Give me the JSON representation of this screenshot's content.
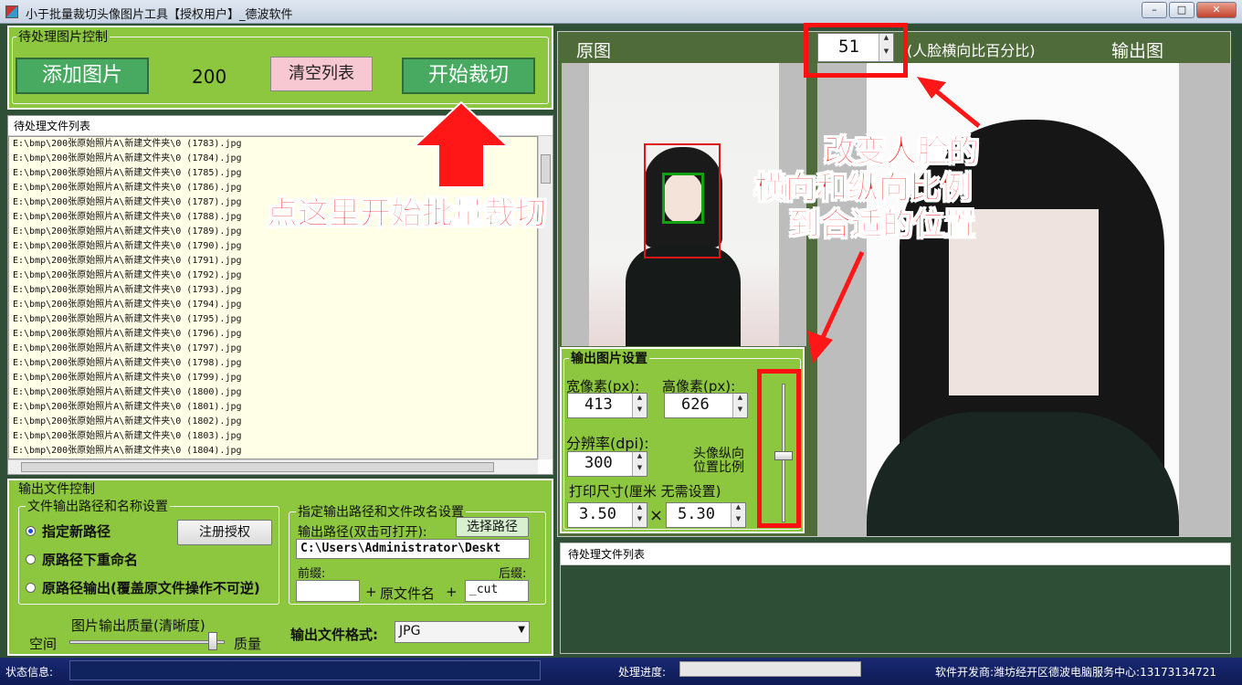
{
  "window": {
    "title": "小于批量裁切头像图片工具【授权用户】_德波软件",
    "min_label": "–",
    "max_label": "□",
    "close_label": "✕"
  },
  "pending_control": {
    "group_title": "待处理图片控制",
    "add_button": "添加图片",
    "count": "200",
    "clear_button": "清空列表",
    "start_button": "开始裁切"
  },
  "file_list": {
    "header": "待处理文件列表",
    "items": [
      "E:\\bmp\\200张原始照片A\\新建文件夹\\0 (1783).jpg",
      "E:\\bmp\\200张原始照片A\\新建文件夹\\0 (1784).jpg",
      "E:\\bmp\\200张原始照片A\\新建文件夹\\0 (1785).jpg",
      "E:\\bmp\\200张原始照片A\\新建文件夹\\0 (1786).jpg",
      "E:\\bmp\\200张原始照片A\\新建文件夹\\0 (1787).jpg",
      "E:\\bmp\\200张原始照片A\\新建文件夹\\0 (1788).jpg",
      "E:\\bmp\\200张原始照片A\\新建文件夹\\0 (1789).jpg",
      "E:\\bmp\\200张原始照片A\\新建文件夹\\0 (1790).jpg",
      "E:\\bmp\\200张原始照片A\\新建文件夹\\0 (1791).jpg",
      "E:\\bmp\\200张原始照片A\\新建文件夹\\0 (1792).jpg",
      "E:\\bmp\\200张原始照片A\\新建文件夹\\0 (1793).jpg",
      "E:\\bmp\\200张原始照片A\\新建文件夹\\0 (1794).jpg",
      "E:\\bmp\\200张原始照片A\\新建文件夹\\0 (1795).jpg",
      "E:\\bmp\\200张原始照片A\\新建文件夹\\0 (1796).jpg",
      "E:\\bmp\\200张原始照片A\\新建文件夹\\0 (1797).jpg",
      "E:\\bmp\\200张原始照片A\\新建文件夹\\0 (1798).jpg",
      "E:\\bmp\\200张原始照片A\\新建文件夹\\0 (1799).jpg",
      "E:\\bmp\\200张原始照片A\\新建文件夹\\0 (1800).jpg",
      "E:\\bmp\\200张原始照片A\\新建文件夹\\0 (1801).jpg",
      "E:\\bmp\\200张原始照片A\\新建文件夹\\0 (1802).jpg",
      "E:\\bmp\\200张原始照片A\\新建文件夹\\0 (1803).jpg",
      "E:\\bmp\\200张原始照片A\\新建文件夹\\0 (1804).jpg"
    ]
  },
  "annotations": {
    "click_here": "点这里开始批量裁切",
    "change_ratio_1": "改变人脸的",
    "change_ratio_2": "横向和纵向比例",
    "change_ratio_3": "到合适的位置"
  },
  "output_control": {
    "group_title": "输出文件控制",
    "path_group_title": "文件输出路径和名称设置",
    "radio_new_path": "指定新路径",
    "radio_rename": "原路径下重命名",
    "radio_overwrite": "原路径输出(覆盖原文件操作不可逆)",
    "register_button": "注册授权",
    "rename_group_title": "指定输出路径和文件改名设置",
    "output_path_label": "输出路径(双击可打开):",
    "choose_path_button": "选择路径",
    "output_path_value": "C:\\Users\\Administrator\\Deskt",
    "prefix_label": "前缀:",
    "suffix_label": "后缀:",
    "prefix_value": "",
    "plus1": "+",
    "orig_name_label": "原文件名",
    "plus2": "+",
    "suffix_value": "_cut",
    "quality_label": "图片输出质量(清晰度)",
    "space_label": "空间",
    "quality_end_label": "质量",
    "quality_fraction": 0.95,
    "format_label": "输出文件格式:",
    "format_value": "JPG"
  },
  "preview": {
    "original_label": "原图",
    "face_ratio_value": "51",
    "face_ratio_label": "(人脸横向比百分比)",
    "output_label": "输出图"
  },
  "output_settings": {
    "group_title": "输出图片设置",
    "width_label": "宽像素(px):",
    "height_label": "高像素(px):",
    "width_value": "413",
    "height_value": "626",
    "dpi_label": "分辨率(dpi):",
    "dpi_value": "300",
    "vertical_ratio_label_1": "头像纵向",
    "vertical_ratio_label_2": "位置比例",
    "print_size_label": "打印尺寸(厘米 无需设置)",
    "print_w": "3.50",
    "times": "×",
    "print_h": "5.30",
    "vertical_ratio_fraction": 0.52
  },
  "right_list": {
    "header": "待处理文件列表"
  },
  "status": {
    "info_label": "状态信息:",
    "progress_label": "处理进度:",
    "progress_fraction": 0,
    "developer": "软件开发商:潍坊经开区德波电脑服务中心:13173134721"
  }
}
